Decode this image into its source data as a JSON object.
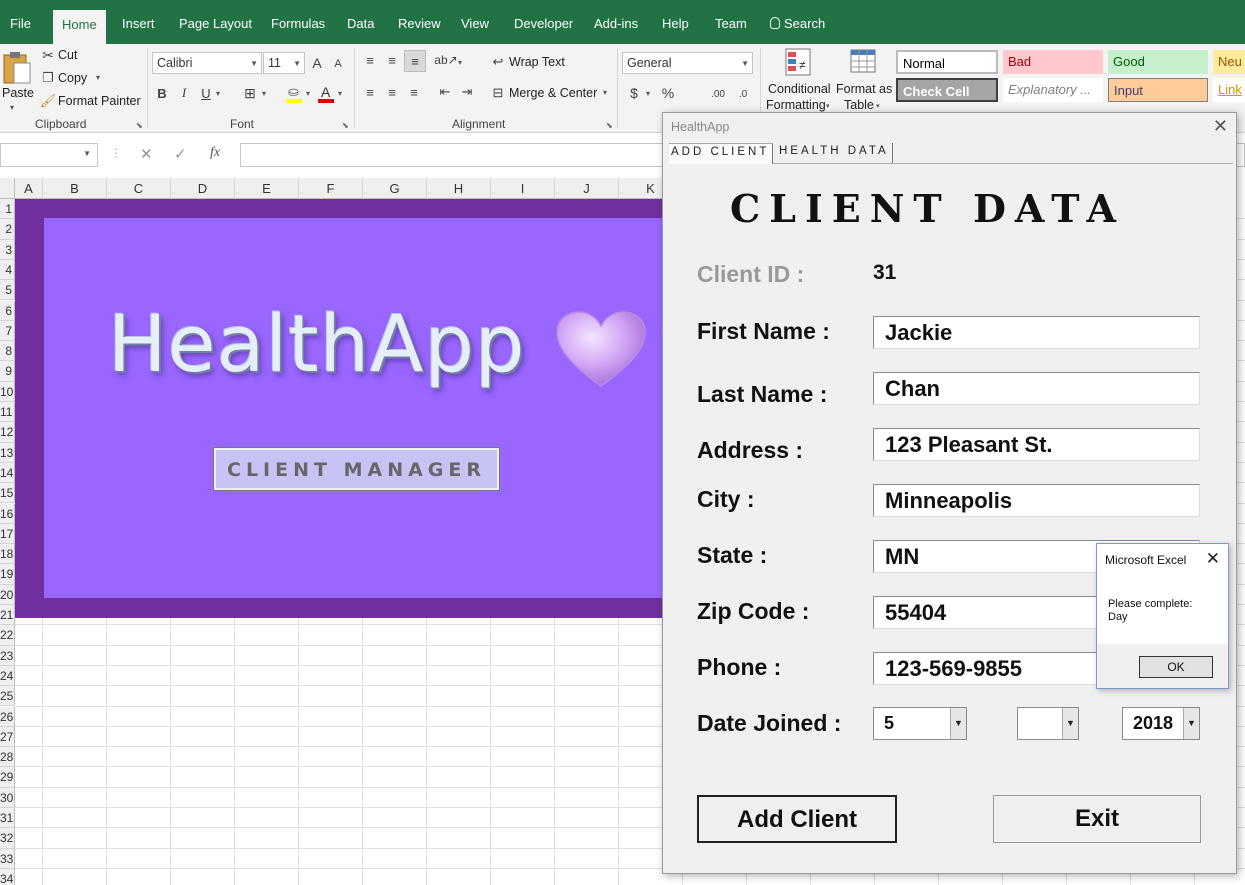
{
  "menu": {
    "items": [
      "File",
      "Home",
      "Insert",
      "Page Layout",
      "Formulas",
      "Data",
      "Review",
      "View",
      "Developer",
      "Add-ins",
      "Help",
      "Team"
    ],
    "search_label": "Search",
    "active": "Home"
  },
  "ribbon": {
    "clipboard": {
      "paste_label": "Paste",
      "cut_label": "Cut",
      "copy_label": "Copy",
      "format_painter_label": "Format Painter",
      "group_label": "Clipboard"
    },
    "font": {
      "font_name": "Calibri",
      "font_size": "11",
      "group_label": "Font",
      "bold": "B",
      "italic": "I",
      "underline": "U",
      "grow": "A",
      "shrink": "A"
    },
    "alignment": {
      "wrap_text_label": "Wrap Text",
      "merge_center_label": "Merge & Center",
      "group_label": "Alignment"
    },
    "number": {
      "format": "General",
      "currency": "$",
      "percent": "%",
      "increase_decimal": ".00",
      "decrease_decimal": ".0"
    },
    "styles": {
      "conditional_formatting_label": [
        "Conditional",
        "Formatting"
      ],
      "format_as_table_label": [
        "Format as",
        "Table"
      ],
      "cells": [
        {
          "label": "Normal",
          "bg": "#ffffff",
          "color": "#000000"
        },
        {
          "label": "Bad",
          "bg": "#ffc7ce",
          "color": "#9c0006"
        },
        {
          "label": "Good",
          "bg": "#c6efce",
          "color": "#006100"
        },
        {
          "label": "Neu",
          "bg": "#ffeb9c",
          "color": "#9c5700"
        },
        {
          "label": "Check Cell",
          "bg": "#a5a5a5",
          "color": "#ffffff"
        },
        {
          "label": "Explanatory ...",
          "bg": "#ffffff",
          "color": "#7f7f7f"
        },
        {
          "label": "Input",
          "bg": "#ffcc99",
          "color": "#3f3f76"
        },
        {
          "label": "Link",
          "bg": "#ffffff",
          "color": "#cc9900"
        }
      ]
    }
  },
  "formula_bar": {
    "fx_label": "fx",
    "value": ""
  },
  "grid": {
    "columns": [
      "A",
      "B",
      "C",
      "D",
      "E",
      "F",
      "G",
      "H",
      "I",
      "J",
      "K"
    ],
    "rows": [
      "1",
      "2",
      "3",
      "4",
      "5",
      "6",
      "7",
      "8",
      "9",
      "10",
      "11",
      "12",
      "13",
      "14",
      "15",
      "16",
      "17",
      "18",
      "19",
      "20",
      "21",
      "22",
      "23",
      "24",
      "25",
      "26",
      "27",
      "28",
      "29",
      "30",
      "31",
      "32",
      "33",
      "34"
    ]
  },
  "banner": {
    "title": "HealthApp",
    "button_label": "CLIENT  MANAGER",
    "outer_color": "#7030a0",
    "inner_color": "#9966ff"
  },
  "dialog": {
    "window_title": "HealthApp",
    "tabs": [
      "ADD CLIENT",
      "HEALTH DATA"
    ],
    "heading": "CLIENT  DATA",
    "client_id_label": "Client ID :",
    "client_id_value": "31",
    "fields": {
      "first_name": {
        "label": "First Name :",
        "value": "Jackie"
      },
      "last_name": {
        "label": "Last Name :",
        "value": "Chan"
      },
      "address": {
        "label": "Address :",
        "value": "123 Pleasant St."
      },
      "city": {
        "label": "City :",
        "value": "Minneapolis"
      },
      "state": {
        "label": "State :",
        "value": "MN"
      },
      "zip": {
        "label": "Zip Code :",
        "value": "55404"
      },
      "phone": {
        "label": "Phone :",
        "value": "123-569-9855"
      }
    },
    "date_joined": {
      "label": "Date Joined :",
      "month": "5",
      "day": "",
      "year": "2018"
    },
    "add_button_label": "Add Client",
    "exit_button_label": "Exit"
  },
  "msgbox": {
    "title": "Microsoft Excel",
    "message": "Please complete:\nDay",
    "ok_label": "OK"
  }
}
